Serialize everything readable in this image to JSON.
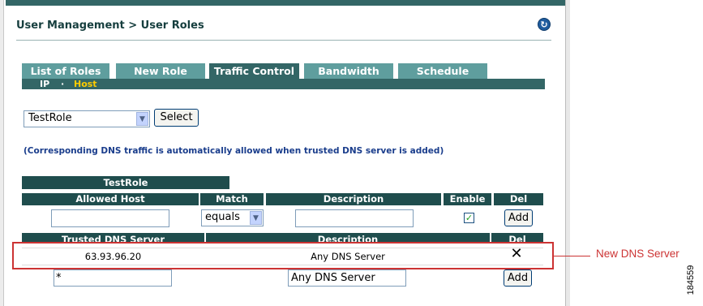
{
  "page": {
    "title": "User Management > User Roles",
    "help_icon": "refresh-help-icon"
  },
  "tabs": [
    {
      "label": "List of Roles",
      "active": false
    },
    {
      "label": "New Role",
      "active": false
    },
    {
      "label": "Traffic Control",
      "active": true
    },
    {
      "label": "Bandwidth",
      "active": false
    },
    {
      "label": "Schedule",
      "active": false
    }
  ],
  "subtabs": {
    "ip": "IP",
    "separator": "·",
    "host": "Host"
  },
  "role_select": {
    "value": "TestRole",
    "button": "Select"
  },
  "note": "(Corresponding DNS traffic is automatically allowed when trusted DNS server is added)",
  "role_header": "TestRole",
  "allowed_host_table": {
    "headers": [
      "Allowed Host",
      "Match",
      "Description",
      "Enable",
      "Del"
    ],
    "new_row": {
      "host": "",
      "match": "equals",
      "description": "",
      "enabled": true,
      "button": "Add"
    }
  },
  "dns_table": {
    "headers": [
      "Trusted DNS Server",
      "Description",
      "Del"
    ],
    "rows": [
      {
        "server": "63.93.96.20",
        "description": "Any DNS Server",
        "delete_icon": "x-delete-icon"
      }
    ],
    "new_row": {
      "server": "*",
      "description": "Any DNS Server",
      "button": "Add"
    }
  },
  "callout": {
    "label": "New DNS Server",
    "color": "#cc3333"
  },
  "figure_id": "184559",
  "colors": {
    "header_dark": "#1f4d4d",
    "tab": "#5f9e9e",
    "tab_active": "#336666",
    "subtab_current": "#ffcc00"
  }
}
